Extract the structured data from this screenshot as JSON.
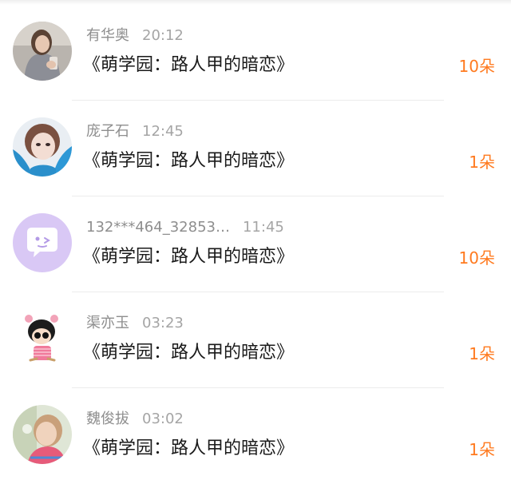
{
  "records": [
    {
      "name": "有华奥",
      "time": "20:12",
      "title": "《萌学园：路人甲的暗恋》",
      "gift": "10朵",
      "avatar_icon": "woman-photo-avatar-icon"
    },
    {
      "name": "庞子石",
      "time": "12:45",
      "title": "《萌学园：路人甲的暗恋》",
      "gift": "1朵",
      "avatar_icon": "girl-blue-hair-avatar-icon"
    },
    {
      "name": "132***464_32853…",
      "time": "11:45",
      "title": "《萌学园：路人甲的暗恋》",
      "gift": "10朵",
      "avatar_icon": "default-chat-bubble-avatar-icon"
    },
    {
      "name": "渠亦玉",
      "time": "03:23",
      "title": "《萌学园：路人甲的暗恋》",
      "gift": "1朵",
      "avatar_icon": "cartoon-girl-avatar-icon"
    },
    {
      "name": "魏俊拔",
      "time": "03:02",
      "title": "《萌学园：路人甲的暗恋》",
      "gift": "1朵",
      "avatar_icon": "child-photo-avatar-icon"
    }
  ],
  "colors": {
    "gift": "#ff7a1f",
    "name": "#8e8e8e",
    "title": "#1a1a1a",
    "default_avatar_bg": "#d9c8f5"
  }
}
